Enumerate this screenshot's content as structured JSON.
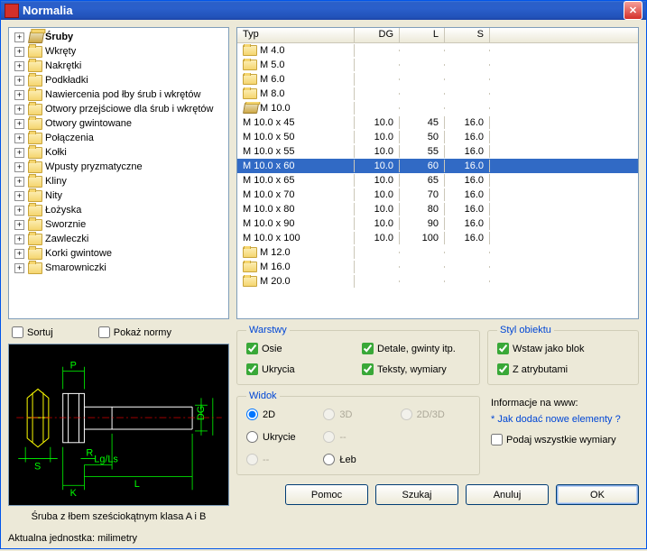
{
  "window": {
    "title": "Normalia"
  },
  "tree": {
    "items": [
      {
        "label": "Śruby",
        "bold": true,
        "open": true
      },
      {
        "label": "Wkręty"
      },
      {
        "label": "Nakrętki"
      },
      {
        "label": "Podkładki"
      },
      {
        "label": "Nawiercenia pod łby śrub i wkrętów"
      },
      {
        "label": "Otwory przejściowe dla śrub i wkrętów"
      },
      {
        "label": "Otwory gwintowane"
      },
      {
        "label": "Połączenia"
      },
      {
        "label": "Kołki"
      },
      {
        "label": "Wpusty pryzmatyczne"
      },
      {
        "label": "Kliny"
      },
      {
        "label": "Nity"
      },
      {
        "label": "Łożyska"
      },
      {
        "label": "Sworznie"
      },
      {
        "label": "Zawleczki"
      },
      {
        "label": "Korki gwintowe"
      },
      {
        "label": "Smarowniczki"
      }
    ]
  },
  "list": {
    "headers": {
      "typ": "Typ",
      "dg": "DG",
      "l": "L",
      "s": "S"
    },
    "rows": [
      {
        "kind": "folder",
        "label": "M 4.0"
      },
      {
        "kind": "folder",
        "label": "M 5.0"
      },
      {
        "kind": "folder",
        "label": "M 6.0"
      },
      {
        "kind": "folder",
        "label": "M 8.0"
      },
      {
        "kind": "folder-open",
        "label": "M 10.0"
      },
      {
        "kind": "item",
        "label": "M 10.0 x 45",
        "dg": "10.0",
        "l": "45",
        "s": "16.0"
      },
      {
        "kind": "item",
        "label": "M 10.0 x 50",
        "dg": "10.0",
        "l": "50",
        "s": "16.0"
      },
      {
        "kind": "item",
        "label": "M 10.0 x 55",
        "dg": "10.0",
        "l": "55",
        "s": "16.0"
      },
      {
        "kind": "item",
        "label": "M 10.0 x 60",
        "dg": "10.0",
        "l": "60",
        "s": "16.0",
        "selected": true
      },
      {
        "kind": "item",
        "label": "M 10.0 x 65",
        "dg": "10.0",
        "l": "65",
        "s": "16.0"
      },
      {
        "kind": "item",
        "label": "M 10.0 x 70",
        "dg": "10.0",
        "l": "70",
        "s": "16.0"
      },
      {
        "kind": "item",
        "label": "M 10.0 x 80",
        "dg": "10.0",
        "l": "80",
        "s": "16.0"
      },
      {
        "kind": "item",
        "label": "M 10.0 x 90",
        "dg": "10.0",
        "l": "90",
        "s": "16.0"
      },
      {
        "kind": "item",
        "label": "M 10.0 x 100",
        "dg": "10.0",
        "l": "100",
        "s": "16.0"
      },
      {
        "kind": "folder",
        "label": "M 12.0"
      },
      {
        "kind": "folder",
        "label": "M 16.0"
      },
      {
        "kind": "folder",
        "label": "M 20.0"
      }
    ]
  },
  "options": {
    "sortuj": "Sortuj",
    "pokaz_normy": "Pokaż normy"
  },
  "preview": {
    "caption": "Śruba z łbem sześciokątnym klasa A i B",
    "unit": "Aktualna jednostka: milimetry",
    "labels": {
      "p": "P",
      "s": "S",
      "r": "R",
      "k": "K",
      "ls": "Lg/Ls",
      "l": "L",
      "dg": "DG"
    }
  },
  "warstwy": {
    "legend": "Warstwy",
    "osie": "Osie",
    "detale": "Detale, gwinty itp.",
    "ukrycia": "Ukrycia",
    "teksty": "Teksty, wymiary"
  },
  "styl": {
    "legend": "Styl obiektu",
    "blok": "Wstaw jako blok",
    "atrybuty": "Z atrybutami"
  },
  "widok": {
    "legend": "Widok",
    "r2d": "2D",
    "r3d": "3D",
    "r2d3d": "2D/3D",
    "ukrycie": "Ukrycie",
    "dash": "--",
    "leb": "Łeb"
  },
  "info": {
    "label": "Informacje na www:",
    "link": "* Jak dodać nowe elementy ?",
    "podaj": "Podaj wszystkie wymiary"
  },
  "buttons": {
    "pomoc": "Pomoc",
    "szukaj": "Szukaj",
    "anuluj": "Anuluj",
    "ok": "OK"
  }
}
